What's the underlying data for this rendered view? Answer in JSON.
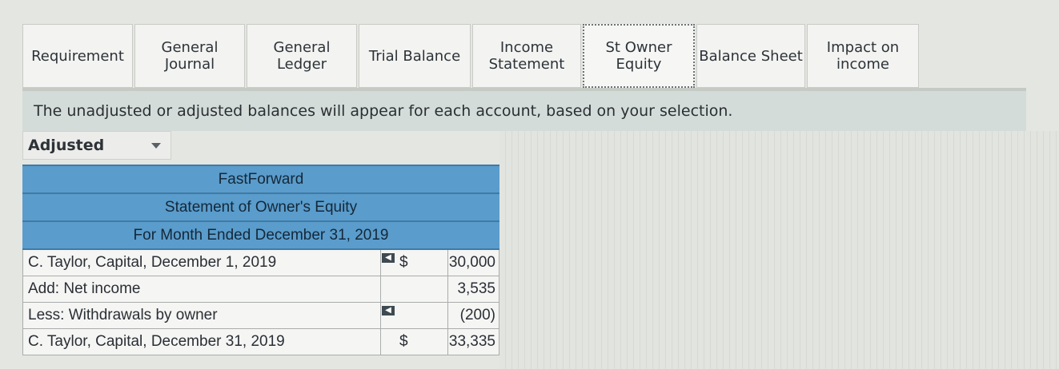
{
  "tabs": [
    {
      "label": "Requirement"
    },
    {
      "label": "General\nJournal"
    },
    {
      "label": "General\nLedger"
    },
    {
      "label": "Trial Balance"
    },
    {
      "label": "Income\nStatement"
    },
    {
      "label": "St Owner\nEquity"
    },
    {
      "label": "Balance Sheet"
    },
    {
      "label": "Impact on\nincome"
    }
  ],
  "info_text": "The unadjusted or adjusted balances will appear for each account, based on your selection.",
  "balance_select": {
    "selected": "Adjusted"
  },
  "statement": {
    "company": "FastForward",
    "title": "Statement of Owner's Equity",
    "period": "For Month Ended December 31, 2019",
    "rows": [
      {
        "label": "C. Taylor, Capital, December 1, 2019",
        "currency": "$",
        "amount": "30,000"
      },
      {
        "label": "Add: Net income",
        "currency": "",
        "amount": "3,535"
      },
      {
        "label": "Less: Withdrawals by owner",
        "currency": "",
        "amount": "(200)"
      },
      {
        "label": "C. Taylor, Capital, December 31, 2019",
        "currency": "$",
        "amount": "33,335"
      }
    ]
  }
}
